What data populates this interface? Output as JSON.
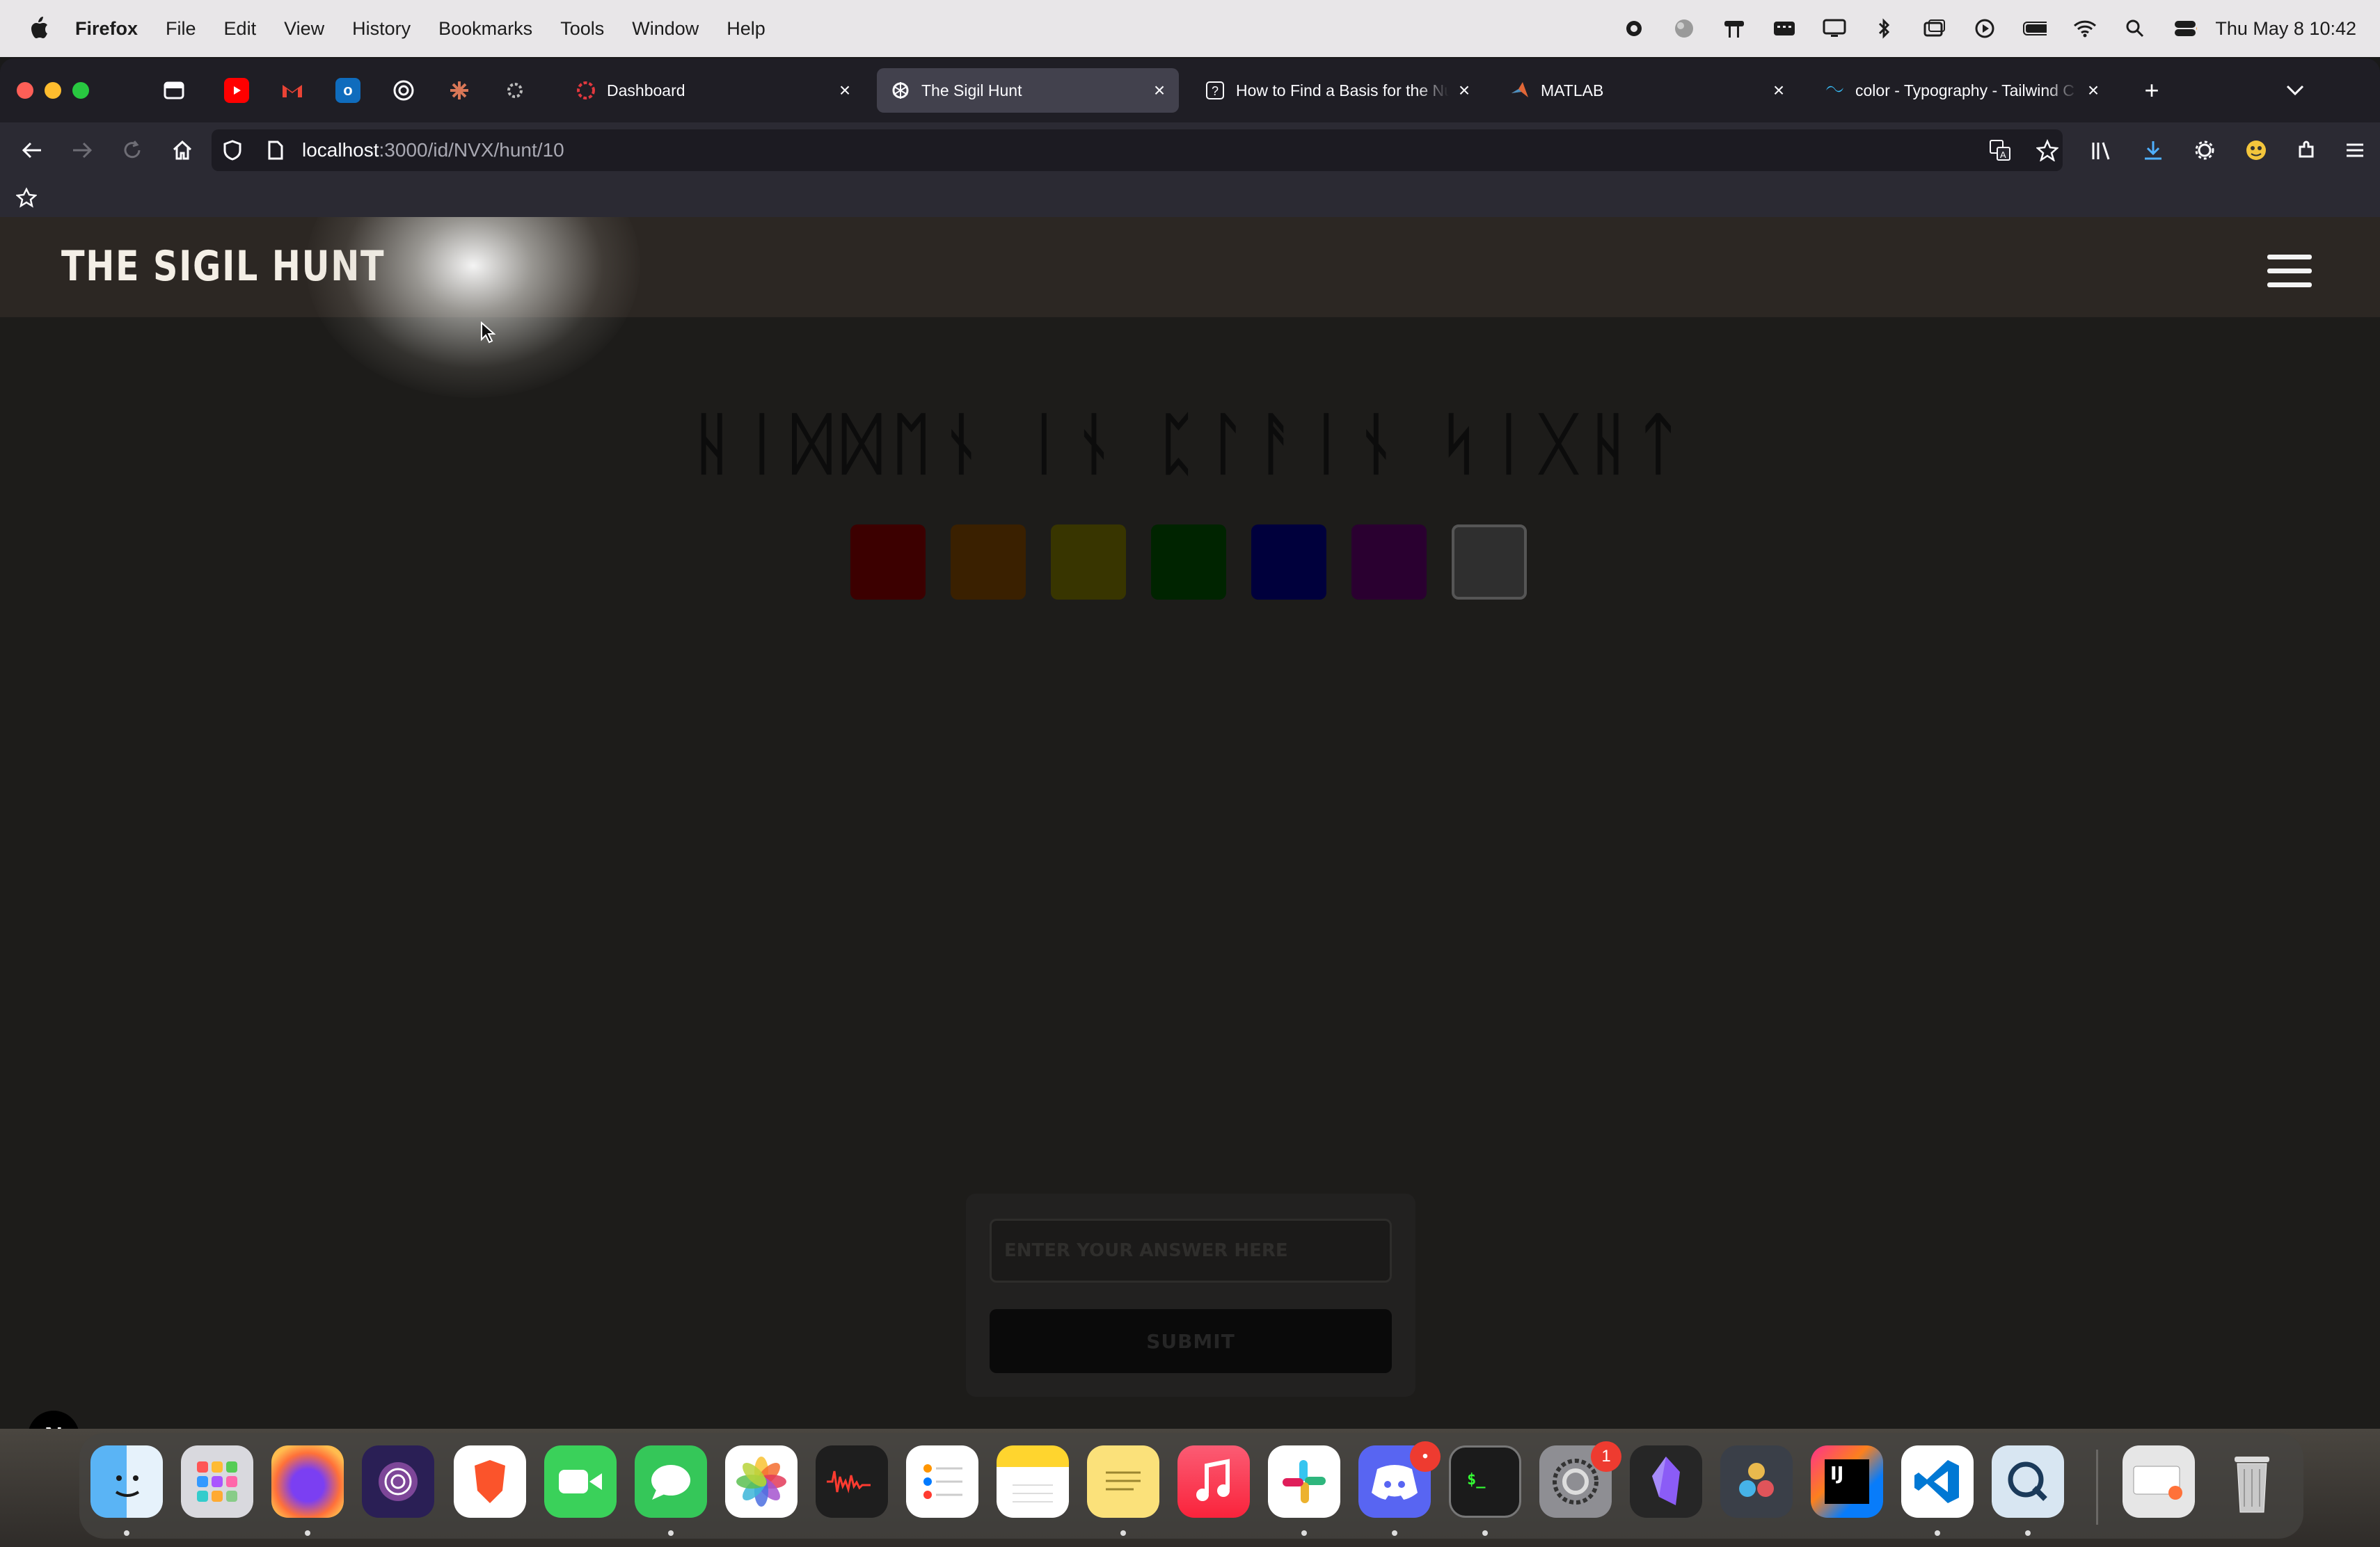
{
  "menubar": {
    "app_name": "Firefox",
    "items": [
      "File",
      "Edit",
      "View",
      "History",
      "Bookmarks",
      "Tools",
      "Window",
      "Help"
    ],
    "clock": "Thu May 8  10:42"
  },
  "tabs": [
    {
      "label": "Dashboard",
      "icon": "dashboard-favicon"
    },
    {
      "label": "The Sigil Hunt",
      "icon": "sigil-favicon",
      "active": true
    },
    {
      "label": "How to Find a Basis for the Null",
      "icon": "question-favicon"
    },
    {
      "label": "MATLAB",
      "icon": "matlab-favicon"
    },
    {
      "label": "color - Typography - Tailwind C",
      "icon": "tailwind-favicon"
    }
  ],
  "urlbar": {
    "host": "localhost",
    "path": ":3000/id/NVX/hunt/10"
  },
  "site": {
    "logo": "THE SIGIL HUNT",
    "rune_title": "ᚺᛁᛞᛞᛖᚾ ᛁᚾ ᛈᛚᚨᛁᚾ ᛋᛁᚷᚺᛏ",
    "swatch_colors": [
      "#3c0000",
      "#3a2000",
      "#383500",
      "#002400",
      "#00003c",
      "#2a0030",
      "#2f2f2f"
    ],
    "answer_placeholder": "ENTER YOUR ANSWER HERE",
    "submit_label": "SUBMIT",
    "dev_badge": "N"
  },
  "dock": {
    "badges": {
      "discord": "•",
      "system_settings": "1"
    }
  },
  "colors": {
    "header_bg": "#2c2723",
    "page_bg": "#1d1c1a",
    "browser_chrome": "#2b2a33"
  }
}
